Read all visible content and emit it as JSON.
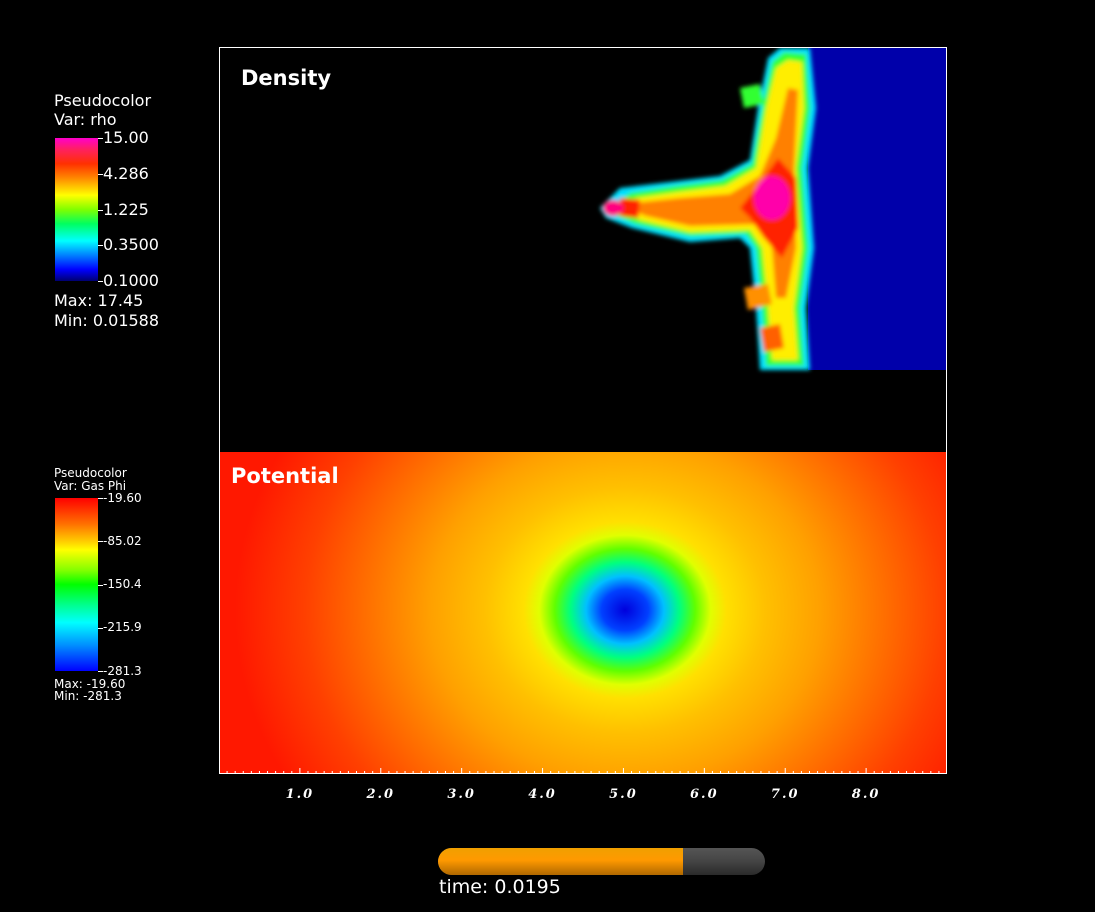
{
  "density_legend": {
    "plot_type": "Pseudocolor",
    "var_label": "Var: rho",
    "ticks": [
      "15.00",
      "4.286",
      "1.225",
      "0.3500",
      "0.1000"
    ],
    "max_label": "Max:  17.45",
    "min_label": "Min:  0.01588"
  },
  "potential_legend": {
    "plot_type": "Pseudocolor",
    "var_label": "Var: Gas Phi",
    "ticks": [
      "-19.60",
      "-85.02",
      "-150.4",
      "-215.9",
      "-281.3"
    ],
    "max_label": "Max: -19.60",
    "min_label": "Min: -281.3"
  },
  "panels": {
    "density_title": "Density",
    "potential_title": "Potential"
  },
  "x_axis": {
    "range": [
      0,
      9
    ],
    "labels": [
      "1.0",
      "2.0",
      "3.0",
      "4.0",
      "5.0",
      "6.0",
      "7.0",
      "8.0"
    ]
  },
  "time_slider": {
    "label": "time: 0.0195",
    "progress": 0.75
  },
  "colors": {
    "background": "#000000",
    "density_ambient": "#0000aa",
    "slider_fill": "#ff9900",
    "slider_track": "#444444"
  }
}
